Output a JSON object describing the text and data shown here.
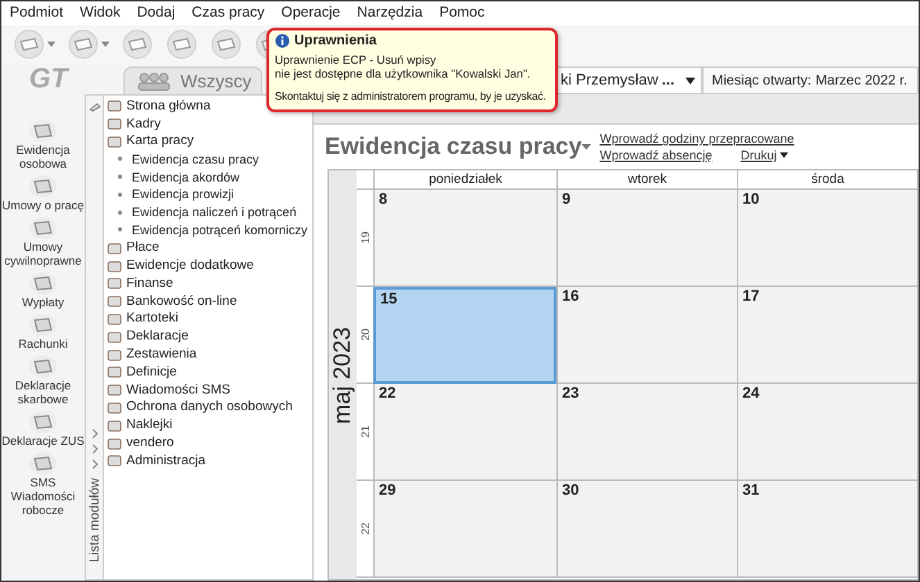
{
  "menu": [
    "Podmiot",
    "Widok",
    "Dodaj",
    "Czas pracy",
    "Operacje",
    "Narzędzia",
    "Pomoc"
  ],
  "toolbar": [
    {
      "kind": "dropdown"
    },
    {
      "kind": "dropdown"
    },
    {
      "kind": "plain"
    },
    {
      "kind": "plain"
    },
    {
      "kind": "plain"
    },
    {
      "kind": "plain"
    }
  ],
  "logo": "GT",
  "header": {
    "group_tab": "Wszyscy",
    "employee": "ki Przemysław",
    "more": "...",
    "open_month_label": "Miesiąc otwarty:",
    "open_month": "Marzec 2022 r."
  },
  "tooltip": {
    "title": "Uprawnienia",
    "lines": [
      "Uprawnienie ECP - Usuń wpisy",
      "nie jest dostępne dla użytkownika \"Kowalski Jan\"."
    ],
    "footer": "Skontaktuj się z administratorem programu, by je uzyskać."
  },
  "sidebar": {
    "items": [
      {
        "label": "Ewidencja osobowa"
      },
      {
        "label": "Umowy o pracę"
      },
      {
        "label": "Umowy cywilnoprawne"
      },
      {
        "label": "Wypłaty"
      },
      {
        "label": "Rachunki"
      },
      {
        "label": "Deklaracje skarbowe"
      },
      {
        "label": "Deklaracje ZUS"
      },
      {
        "label": "SMS Wiadomości robocze"
      }
    ]
  },
  "modules": {
    "title": "Lista modułów",
    "items": [
      {
        "label": "Strona główna"
      },
      {
        "label": "Kadry"
      },
      {
        "label": "Karta pracy",
        "children": [
          {
            "label": "Ewidencja czasu pracy"
          },
          {
            "label": "Ewidencja akordów"
          },
          {
            "label": "Ewidencja prowizji"
          },
          {
            "label": "Ewidencja naliczeń i potrąceń"
          },
          {
            "label": "Ewidencja potrąceń komorniczy"
          }
        ]
      },
      {
        "label": "Płace"
      },
      {
        "label": "Ewidencje dodatkowe"
      },
      {
        "label": "Finanse"
      },
      {
        "label": "Bankowość on-line"
      },
      {
        "label": "Kartoteki"
      },
      {
        "label": "Deklaracje"
      },
      {
        "label": "Zestawienia"
      },
      {
        "label": "Definicje"
      },
      {
        "label": "Wiadomości SMS"
      },
      {
        "label": "Ochrona danych osobowych"
      },
      {
        "label": "Naklejki"
      },
      {
        "label": "vendero"
      },
      {
        "label": "Administracja"
      }
    ]
  },
  "calendar": {
    "title": "Ewidencja czasu pracy",
    "links": [
      "Wprowadź godziny przepracowane",
      "Wprowadź absencję"
    ],
    "print": "Drukuj",
    "month": "maj 2023",
    "columns": [
      "poniedziałek",
      "wtorek",
      "środa"
    ],
    "weeks": [
      {
        "number": "19",
        "days": [
          {
            "date": "8",
            "selected": false
          },
          {
            "date": "9",
            "selected": false
          },
          {
            "date": "10",
            "selected": false
          }
        ]
      },
      {
        "number": "20",
        "days": [
          {
            "date": "15",
            "selected": true
          },
          {
            "date": "16",
            "selected": false
          },
          {
            "date": "17",
            "selected": false
          }
        ]
      },
      {
        "number": "21",
        "days": [
          {
            "date": "22",
            "selected": false
          },
          {
            "date": "23",
            "selected": false
          },
          {
            "date": "24",
            "selected": false
          }
        ]
      },
      {
        "number": "22",
        "days": [
          {
            "date": "29",
            "selected": false
          },
          {
            "date": "30",
            "selected": false
          },
          {
            "date": "31",
            "selected": false
          }
        ]
      }
    ]
  }
}
